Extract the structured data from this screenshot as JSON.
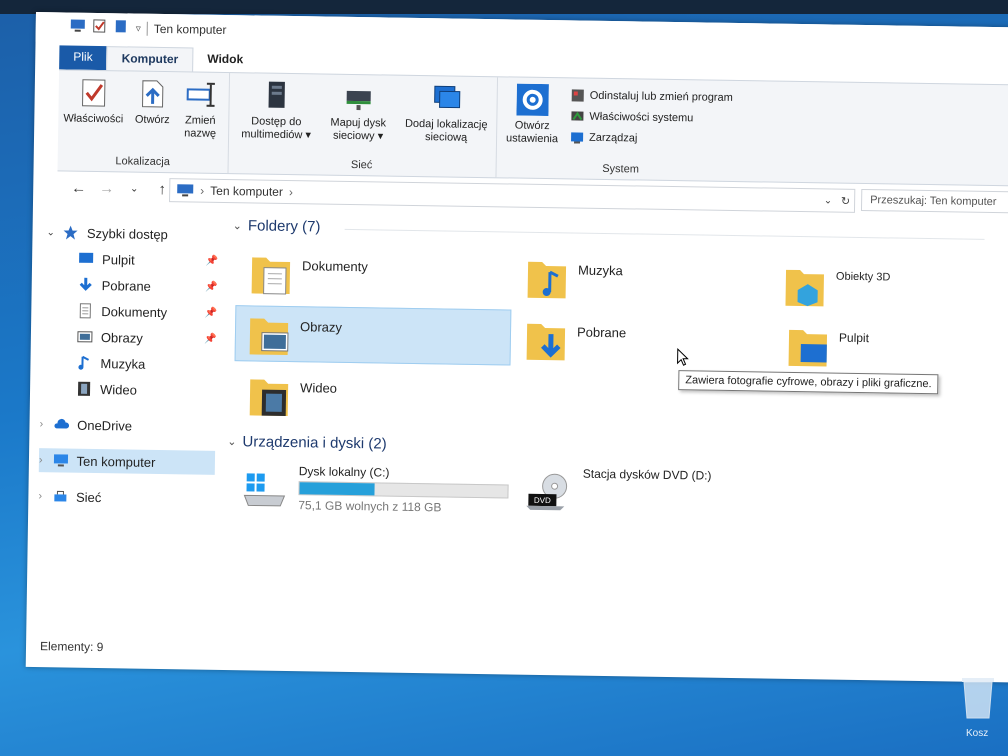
{
  "window": {
    "title": "Ten komputer",
    "tabs": [
      "Plik",
      "Komputer",
      "Widok"
    ]
  },
  "ribbon": {
    "groups": {
      "lokalizacja": {
        "label": "Lokalizacja",
        "buttons": [
          {
            "label": "Właściwości"
          },
          {
            "label": "Otwórz"
          },
          {
            "label": "Zmień nazwę"
          }
        ]
      },
      "siec": {
        "label": "Sieć",
        "buttons": [
          {
            "label": "Dostęp do multimediów ▾"
          },
          {
            "label": "Mapuj dysk sieciowy ▾"
          },
          {
            "label": "Dodaj lokalizację sieciową"
          }
        ]
      },
      "system": {
        "label": "System",
        "big_button": "Otwórz ustawienia",
        "small_buttons": [
          "Odinstaluj lub zmień program",
          "Właściwości systemu",
          "Zarządzaj"
        ]
      }
    }
  },
  "navbar": {
    "breadcrumb": [
      "Ten komputer"
    ],
    "search_placeholder": "Przeszukaj: Ten komputer"
  },
  "sidebar": {
    "quick_access": "Szybki dostęp",
    "items": [
      {
        "label": "Pulpit",
        "icon": "desktop-icon"
      },
      {
        "label": "Pobrane",
        "icon": "download-icon"
      },
      {
        "label": "Dokumenty",
        "icon": "document-icon"
      },
      {
        "label": "Obrazy",
        "icon": "pictures-icon"
      },
      {
        "label": "Muzyka",
        "icon": "music-icon"
      },
      {
        "label": "Wideo",
        "icon": "video-icon"
      }
    ],
    "onedrive": "OneDrive",
    "this_pc": "Ten komputer",
    "network": "Sieć"
  },
  "content": {
    "folders_header": "Foldery (7)",
    "folders": [
      {
        "label": "Dokumenty"
      },
      {
        "label": "Muzyka"
      },
      {
        "label": "Obiekty 3D"
      },
      {
        "label": "Obrazy"
      },
      {
        "label": "Pobrane"
      },
      {
        "label": "Pulpit"
      },
      {
        "label": "Wideo"
      }
    ],
    "tooltip": "Zawiera fotografie cyfrowe, obrazy i pliki graficzne.",
    "devices_header": "Urządzenia i dyski (2)",
    "drives": [
      {
        "name": "Dysk lokalny (C:)",
        "free": "75,1 GB wolnych z 118 GB",
        "used_fraction": 0.36
      },
      {
        "name": "Stacja dysków DVD (D:)"
      }
    ]
  },
  "status": {
    "items": "Elementy: 9"
  },
  "desktop": {
    "recycle_bin": "Kosz"
  },
  "colors": {
    "accent": "#1a5aa8",
    "selection": "#cce4f7",
    "folder": "#f0c24b",
    "drive_bar": "#26a0da"
  }
}
